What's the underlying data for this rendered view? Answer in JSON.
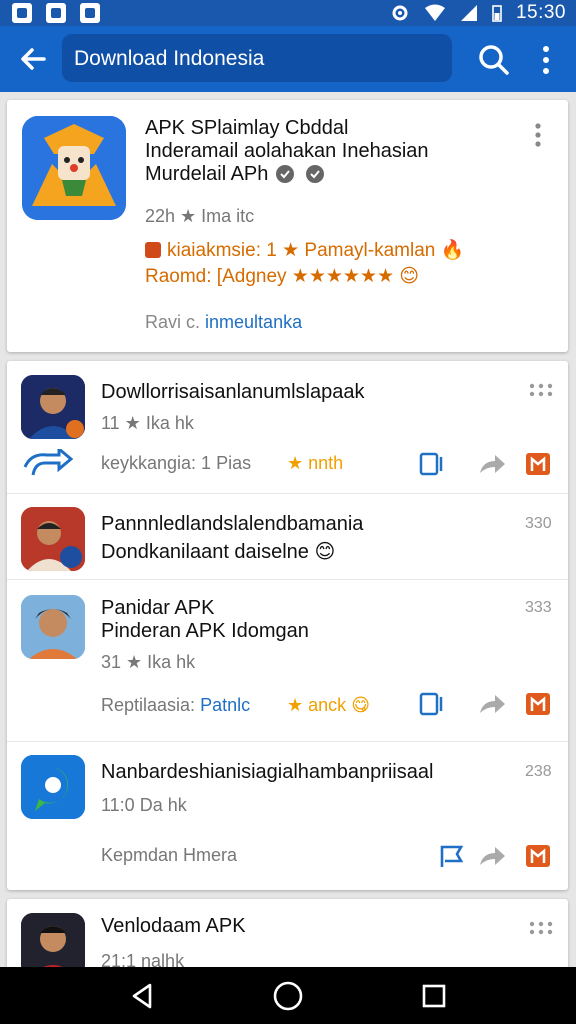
{
  "status_bar": {
    "time": "15:30"
  },
  "app_bar": {
    "search_text": "Download Indonesia"
  },
  "colors": {
    "primary": "#1565c8",
    "statusbar": "#1a58ad",
    "accent_orange": "#e05a1e",
    "star": "#f0a000",
    "link": "#1f6fc6"
  },
  "hero": {
    "title_line1": "APK SPlaimlay Cbddal",
    "title_line2": "Inderamail aolahakan Inehasian",
    "title_line3": "Murdelail APh",
    "meta": "22h ★ Ima itc",
    "promo_line1": "kiaiakmsie: 1 ★ Pamayl-kamlan",
    "promo_line2": "Raomd: [Adgney ★★★★★★",
    "footer_label": "Ravi c.",
    "footer_link": "inmeultanka"
  },
  "items": [
    {
      "title": "Dowllorrisaisanlanumlslapaak",
      "meta": "11 ★ Ika hk",
      "detail_label": "keykkangia: 1 Pias",
      "detail_tag": "★ nnth",
      "count": ""
    },
    {
      "title": "Pannnledlandslalendbamania",
      "subtitle": "Dondkanilaant daiselne",
      "count": "330"
    },
    {
      "title": "Panidar APK",
      "subtitle": "Pinderan APK Idomgan",
      "meta": "31 ★ Ika hk",
      "detail_label": "Reptilaasia:",
      "detail_link": "Patnlc",
      "detail_tag": "★ anck",
      "count": "333"
    },
    {
      "title": "Nanbardeshianisiagialhambanpriisaal",
      "meta": "11:0 Da hk",
      "detail_label": "Kepmdan Hmera",
      "count": "238"
    },
    {
      "title": "Venlodaam APK",
      "meta": "21:1 nalhk",
      "count": ""
    }
  ]
}
